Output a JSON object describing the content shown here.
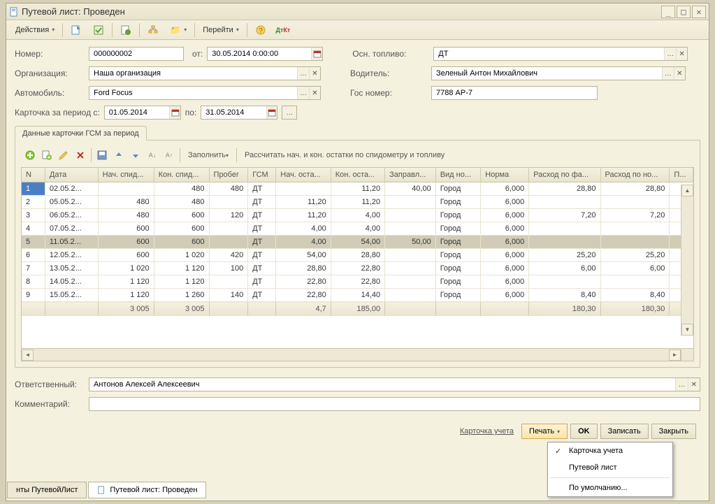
{
  "title": "Путевой лист: Проведен",
  "toolbar": {
    "actions": "Действия",
    "goto": "Перейти"
  },
  "labels": {
    "number": "Номер:",
    "from": "от:",
    "org": "Организация:",
    "auto": "Автомобиль:",
    "card_period": "Карточка за период с:",
    "to": "по:",
    "fuel": "Осн. топливо:",
    "driver": "Водитель:",
    "regnum": "Гос номер:",
    "responsible": "Ответственный:",
    "comment": "Комментарий:"
  },
  "fields": {
    "number": "000000002",
    "date": "30.05.2014 0:00:00",
    "org": "Наша организация",
    "auto": "Ford Focus",
    "period_from": "01.05.2014",
    "period_to": "31.05.2014",
    "fuel": "ДТ",
    "driver": "Зеленый Антон Михайлович",
    "regnum": "7788 АР-7",
    "responsible": "Антонов Алексей Алексеевич",
    "comment": ""
  },
  "tab": {
    "label": "Данные карточки ГСМ за период"
  },
  "grid_toolbar": {
    "fill": "Заполнить",
    "recalc": "Рассчитать нач. и кон. остатки по спидометру и топливу"
  },
  "grid": {
    "headers": [
      "N",
      "Дата",
      "Нач. спид...",
      "Кон. спид...",
      "Пробег",
      "ГСМ",
      "Нач. оста...",
      "Кон. оста...",
      "Заправл...",
      "Вид но...",
      "Норма",
      "Расход по фа...",
      "Расход по но...",
      "П..."
    ],
    "rows": [
      {
        "n": "1",
        "date": "02.05.2...",
        "nspid": "",
        "kspid": "480",
        "probeg": "480",
        "gsm": "ДТ",
        "nost": "",
        "kost": "11,20",
        "zapr": "40,00",
        "vid": "Город",
        "norma": "6,000",
        "rfact": "28,80",
        "rnorm": "28,80"
      },
      {
        "n": "2",
        "date": "05.05.2...",
        "nspid": "480",
        "kspid": "480",
        "probeg": "",
        "gsm": "ДТ",
        "nost": "11,20",
        "kost": "11,20",
        "zapr": "",
        "vid": "Город",
        "norma": "6,000",
        "rfact": "",
        "rnorm": ""
      },
      {
        "n": "3",
        "date": "06.05.2...",
        "nspid": "480",
        "kspid": "600",
        "probeg": "120",
        "gsm": "ДТ",
        "nost": "11,20",
        "kost": "4,00",
        "zapr": "",
        "vid": "Город",
        "norma": "6,000",
        "rfact": "7,20",
        "rnorm": "7,20"
      },
      {
        "n": "4",
        "date": "07.05.2...",
        "nspid": "600",
        "kspid": "600",
        "probeg": "",
        "gsm": "ДТ",
        "nost": "4,00",
        "kost": "4,00",
        "zapr": "",
        "vid": "Город",
        "norma": "6,000",
        "rfact": "",
        "rnorm": ""
      },
      {
        "n": "5",
        "date": "11.05.2...",
        "nspid": "600",
        "kspid": "600",
        "probeg": "",
        "gsm": "ДТ",
        "nost": "4,00",
        "kost": "54,00",
        "zapr": "50,00",
        "vid": "Город",
        "norma": "6,000",
        "rfact": "",
        "rnorm": ""
      },
      {
        "n": "6",
        "date": "12.05.2...",
        "nspid": "600",
        "kspid": "1 020",
        "probeg": "420",
        "gsm": "ДТ",
        "nost": "54,00",
        "kost": "28,80",
        "zapr": "",
        "vid": "Город",
        "norma": "6,000",
        "rfact": "25,20",
        "rnorm": "25,20"
      },
      {
        "n": "7",
        "date": "13.05.2...",
        "nspid": "1 020",
        "kspid": "1 120",
        "probeg": "100",
        "gsm": "ДТ",
        "nost": "28,80",
        "kost": "22,80",
        "zapr": "",
        "vid": "Город",
        "norma": "6,000",
        "rfact": "6,00",
        "rnorm": "6,00"
      },
      {
        "n": "8",
        "date": "14.05.2...",
        "nspid": "1 120",
        "kspid": "1 120",
        "probeg": "",
        "gsm": "ДТ",
        "nost": "22,80",
        "kost": "22,80",
        "zapr": "",
        "vid": "Город",
        "norma": "6,000",
        "rfact": "",
        "rnorm": ""
      },
      {
        "n": "9",
        "date": "15.05.2...",
        "nspid": "1 120",
        "kspid": "1 260",
        "probeg": "140",
        "gsm": "ДТ",
        "nost": "22,80",
        "kost": "14,40",
        "zapr": "",
        "vid": "Город",
        "norma": "6,000",
        "rfact": "8,40",
        "rnorm": "8,40"
      }
    ],
    "footer": {
      "nspid": "3 005",
      "kspid": "3 005",
      "nost": "4,7",
      "kost": "185,00",
      "rfact": "180,30",
      "rnorm": "180,30"
    }
  },
  "footer": {
    "card": "Карточка учета",
    "print": "Печать",
    "ok": "OK",
    "save": "Записать",
    "close": "Закрыть"
  },
  "popup": {
    "card": "Карточка учета",
    "trip": "Путевой лист",
    "default": "По умолчанию..."
  },
  "bottom_tabs": {
    "left": "нты ПутевойЛист",
    "right": "Путевой лист: Проведен"
  }
}
